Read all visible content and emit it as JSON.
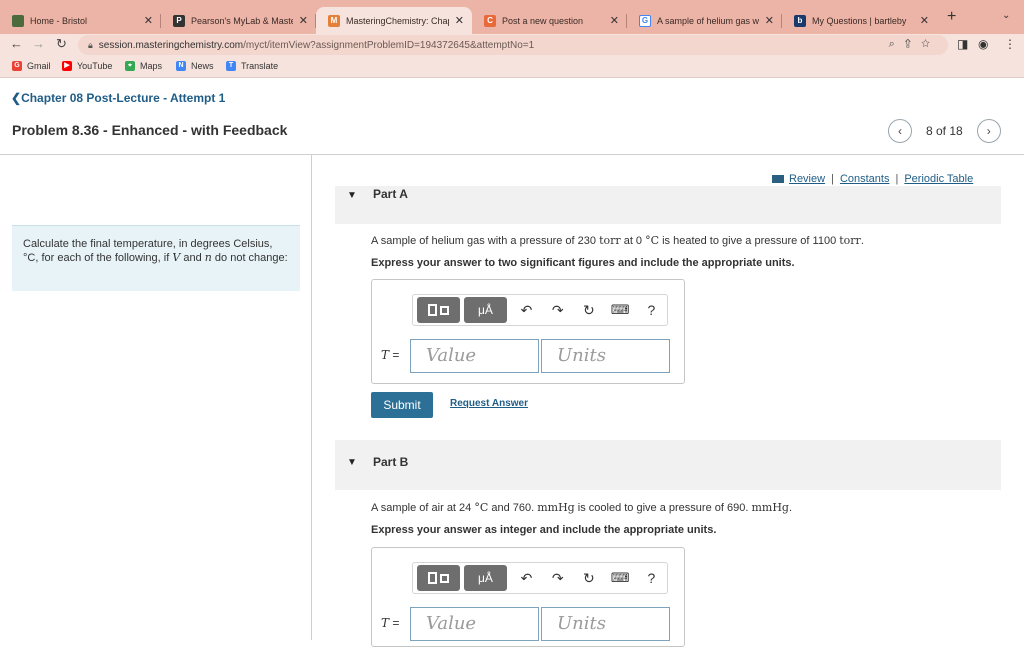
{
  "browser": {
    "tabs": [
      {
        "title": "Home - Bristol",
        "icon": "bristol-icon",
        "color": "#4b6b3c"
      },
      {
        "title": "Pearson's MyLab & Master",
        "icon": "pearson-icon",
        "color": "#333333"
      },
      {
        "title": "MasteringChemistry: Chap",
        "icon": "mastering-icon",
        "color": "#e5803a",
        "active": true
      },
      {
        "title": "Post a new question",
        "icon": "chegg-icon",
        "color": "#e86a3a"
      },
      {
        "title": "A sample of helium gas wit",
        "icon": "google-icon",
        "color": "#4285f4"
      },
      {
        "title": "My Questions | bartleby",
        "icon": "bartleby-icon",
        "color": "#1b3a6b"
      }
    ],
    "url_host": "session.masteringchemistry.com",
    "url_path": "/myct/itemView?assignmentProblemID=194372645&attemptNo=1",
    "bookmarks": [
      {
        "label": "Gmail",
        "icon": "gmail-icon",
        "color": "#ea4335"
      },
      {
        "label": "YouTube",
        "icon": "youtube-icon",
        "color": "#ff0000"
      },
      {
        "label": "Maps",
        "icon": "maps-icon",
        "color": "#34a853"
      },
      {
        "label": "News",
        "icon": "news-icon",
        "color": "#4285f4"
      },
      {
        "label": "Translate",
        "icon": "translate-icon",
        "color": "#4285f4"
      }
    ]
  },
  "header": {
    "back_link": "Chapter 08 Post-Lecture - Attempt 1",
    "title": "Problem 8.36 - Enhanced - with Feedback",
    "pager": "8 of 18"
  },
  "sidebar": {
    "instruction_a": "Calculate the final temperature, in degrees Celsius,",
    "instruction_b": "C, for each of the following, if",
    "instruction_c": "do not change:",
    "var_v": "V",
    "var_n": "n",
    "and": "and",
    "deg": "°"
  },
  "links": {
    "review": "Review",
    "constants": "Constants",
    "periodic": "Periodic Table"
  },
  "partA": {
    "label": "Part A",
    "q_pre": "A sample of helium gas with a pressure of 230",
    "unit_torr": "torr",
    "q_mid": "at 0",
    "deg_c": "°C",
    "q_mid2": "is heated to give a pressure of 1100",
    "q_end": ".",
    "instruction": "Express your answer to two significant figures and include the appropriate units.",
    "var": "T",
    "eq": "=",
    "value_placeholder": "Value",
    "units_placeholder": "Units",
    "submit": "Submit",
    "request": "Request Answer"
  },
  "partB": {
    "label": "Part B",
    "q_pre": "A sample of air at 24",
    "deg_c": "°C",
    "q_mid": "and 760.",
    "unit_mmhg": "mmHg",
    "q_mid2": "is cooled to give a pressure of 690.",
    "q_end": ".",
    "instruction": "Express your answer as integer and include the appropriate units.",
    "var": "T",
    "eq": "=",
    "value_placeholder": "Value",
    "units_placeholder": "Units"
  },
  "toolbar": {
    "mu_label": "μÅ",
    "undo": "↶",
    "redo": "↷",
    "reset": "↻",
    "keyboard": "⌨",
    "help": "?"
  }
}
